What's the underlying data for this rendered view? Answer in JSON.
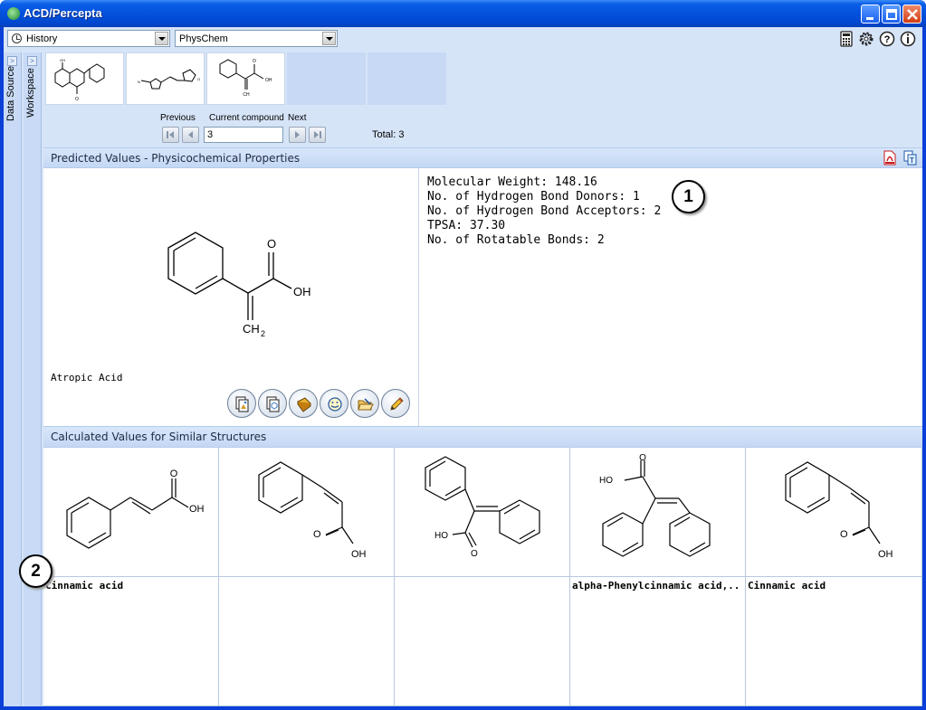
{
  "window": {
    "title": "ACD/Percepta"
  },
  "toolbar": {
    "history_combo": "History",
    "module_combo": "PhysChem",
    "icons": [
      "calculator-icon",
      "gear-icon",
      "help-icon",
      "info-icon"
    ]
  },
  "sidebar": {
    "data_source_label": "Data Source",
    "workspace_label": "Workspace"
  },
  "navigator": {
    "previous_label": "Previous",
    "current_label": "Current compound",
    "next_label": "Next",
    "current_value": "3",
    "total_label": "Total: 3"
  },
  "predicted": {
    "header": "Predicted Values - Physicochemical Properties",
    "compound_name": "Atropic Acid",
    "properties": [
      "Molecular Weight: 148.16",
      "No. of Hydrogen Bond Donors: 1",
      "No. of Hydrogen Bond Acceptors: 2",
      "TPSA: 37.30",
      "No. of Rotatable Bonds: 2"
    ],
    "structure_labels": {
      "o": "O",
      "oh": "OH",
      "ch2": "CH",
      "ch2_sub": "2"
    }
  },
  "similar": {
    "header": "Calculated Values for Similar Structures",
    "names": [
      "Cinnamic acid",
      "",
      "",
      "alpha-Phenylcinnamic acid,..",
      "Cinnamic acid"
    ],
    "labels": {
      "o": "O",
      "oh": "OH",
      "ho": "HO"
    }
  },
  "callouts": {
    "one": "1",
    "two": "2"
  }
}
